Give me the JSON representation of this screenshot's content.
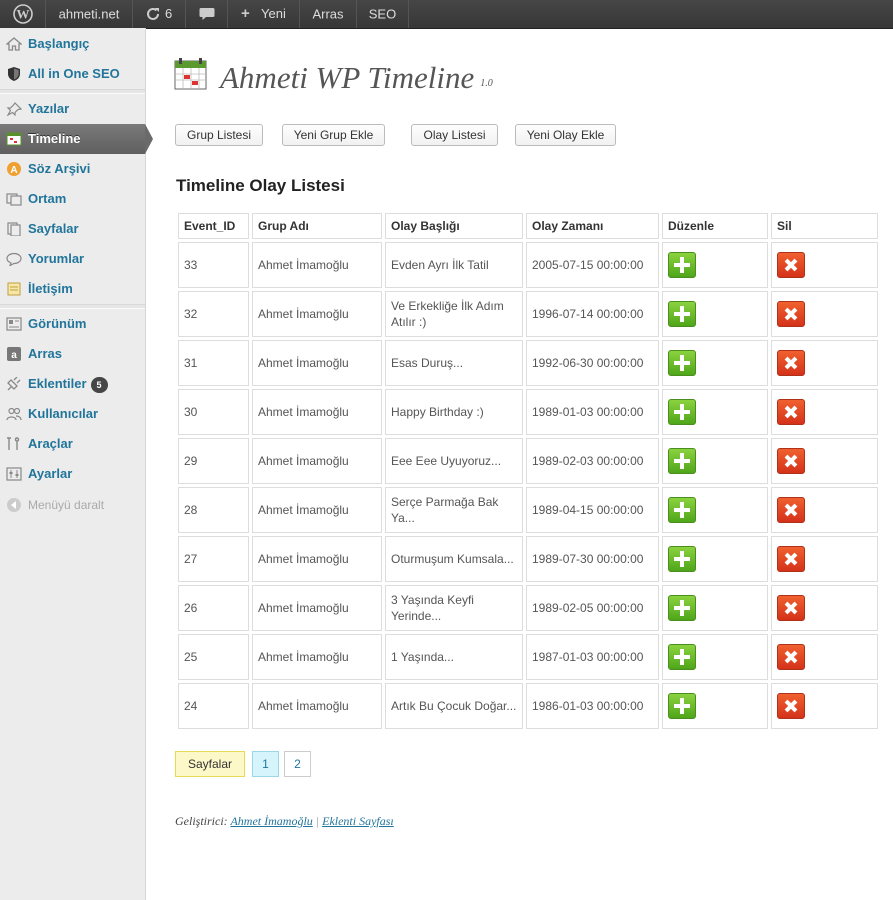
{
  "admin_bar": {
    "site_name": "ahmeti.net",
    "updates_count": "6",
    "new_label": "Yeni",
    "items": [
      "Arras",
      "SEO"
    ]
  },
  "sidebar": {
    "items": [
      {
        "label": "Başlangıç",
        "icon": "home-icon"
      },
      {
        "label": "All in One SEO",
        "icon": "shield-icon"
      },
      {
        "label": "Yazılar",
        "icon": "pin-icon"
      },
      {
        "label": "Timeline",
        "icon": "calendar-icon"
      },
      {
        "label": "Söz Arşivi",
        "icon": "quote-icon"
      },
      {
        "label": "Ortam",
        "icon": "media-icon"
      },
      {
        "label": "Sayfalar",
        "icon": "pages-icon"
      },
      {
        "label": "Yorumlar",
        "icon": "comment-icon"
      },
      {
        "label": "İletişim",
        "icon": "contact-icon"
      },
      {
        "label": "Görünüm",
        "icon": "appearance-icon"
      },
      {
        "label": "Arras",
        "icon": "arras-icon"
      },
      {
        "label": "Eklentiler",
        "icon": "plugin-icon",
        "badge": "5"
      },
      {
        "label": "Kullanıcılar",
        "icon": "users-icon"
      },
      {
        "label": "Araçlar",
        "icon": "tools-icon"
      },
      {
        "label": "Ayarlar",
        "icon": "settings-icon"
      }
    ],
    "collapse_label": "Menüyü daralt"
  },
  "header": {
    "title": "Ahmeti WP Timeline",
    "version": "1.0"
  },
  "toolbar": {
    "group_list": "Grup Listesi",
    "new_group": "Yeni Grup Ekle",
    "event_list": "Olay Listesi",
    "new_event": "Yeni Olay Ekle"
  },
  "section_title": "Timeline Olay Listesi",
  "table": {
    "columns": [
      "Event_ID",
      "Grup Adı",
      "Olay Başlığı",
      "Olay Zamanı",
      "Düzenle",
      "Sil"
    ],
    "rows": [
      {
        "id": "33",
        "group": "Ahmet İmamoğlu",
        "title": "Evden Ayrı İlk Tatil",
        "time": "2005-07-15 00:00:00"
      },
      {
        "id": "32",
        "group": "Ahmet İmamoğlu",
        "title": "Ve Erkekliğe İlk Adım Atılır :)",
        "time": "1996-07-14 00:00:00"
      },
      {
        "id": "31",
        "group": "Ahmet İmamoğlu",
        "title": "Esas Duruş...",
        "time": "1992-06-30 00:00:00"
      },
      {
        "id": "30",
        "group": "Ahmet İmamoğlu",
        "title": "Happy Birthday :)",
        "time": "1989-01-03 00:00:00"
      },
      {
        "id": "29",
        "group": "Ahmet İmamoğlu",
        "title": "Eee Eee Uyuyoruz...",
        "time": "1989-02-03 00:00:00"
      },
      {
        "id": "28",
        "group": "Ahmet İmamoğlu",
        "title": "Serçe Parmağa Bak Ya...",
        "time": "1989-04-15 00:00:00"
      },
      {
        "id": "27",
        "group": "Ahmet İmamoğlu",
        "title": "Oturmuşum Kumsala...",
        "time": "1989-07-30 00:00:00"
      },
      {
        "id": "26",
        "group": "Ahmet İmamoğlu",
        "title": "3 Yaşında Keyfi Yerinde...",
        "time": "1989-02-05 00:00:00"
      },
      {
        "id": "25",
        "group": "Ahmet İmamoğlu",
        "title": "1 Yaşında...",
        "time": "1987-01-03 00:00:00"
      },
      {
        "id": "24",
        "group": "Ahmet İmamoğlu",
        "title": "Artık Bu Çocuk Doğar...",
        "time": "1986-01-03 00:00:00"
      }
    ]
  },
  "pagination": {
    "label": "Sayfalar",
    "pages": [
      "1",
      "2"
    ],
    "current": "1"
  },
  "footer": {
    "prefix": "Geliştirici:",
    "developer": "Ahmet İmamoğlu",
    "separator": "|",
    "plugin_page": "Eklenti Sayfası"
  },
  "colors": {
    "link": "#21759b",
    "edit_green": "#5cb521",
    "delete_red": "#e0401e",
    "pagination_label_bg": "#fdf8c8",
    "pagination_current_bg": "#d6f4fb"
  }
}
